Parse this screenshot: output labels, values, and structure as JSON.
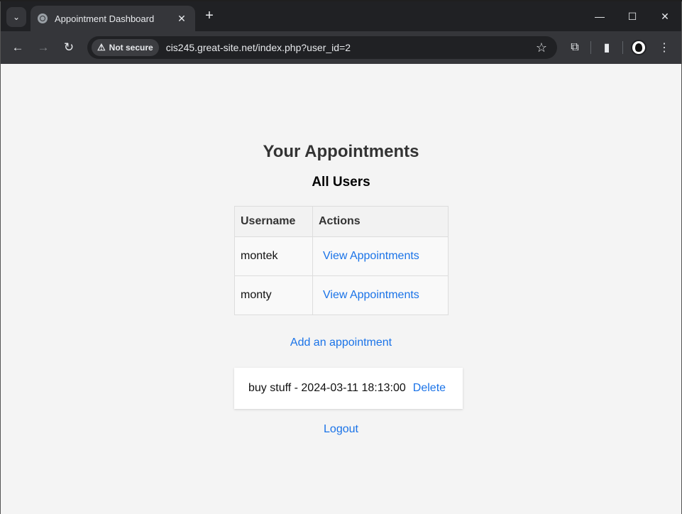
{
  "browser": {
    "tab_title": "Appointment Dashboard",
    "security_label": "Not secure",
    "url": "cis245.great-site.net/index.php?user_id=2"
  },
  "page": {
    "heading": "Your Appointments",
    "users_section_title": "All Users",
    "table": {
      "headers": [
        "Username",
        "Actions"
      ],
      "rows": [
        {
          "username": "montek",
          "action": "View Appointments"
        },
        {
          "username": "monty",
          "action": "View Appointments"
        }
      ]
    },
    "add_link": "Add an appointment",
    "appointments": [
      {
        "text": "buy stuff - 2024-03-11 18:13:00",
        "action": "Delete"
      }
    ],
    "logout_link": "Logout"
  },
  "colors": {
    "link": "#1a73e8",
    "page_background": "#f4f4f4",
    "browser_frame": "#202124"
  },
  "icons": {
    "back": "arrow-left-icon",
    "forward": "arrow-right-icon",
    "reload": "reload-icon",
    "bookmark": "star-icon",
    "extensions": "puzzle-icon",
    "side_panel": "side-panel-icon",
    "menu": "kebab-menu-icon"
  }
}
